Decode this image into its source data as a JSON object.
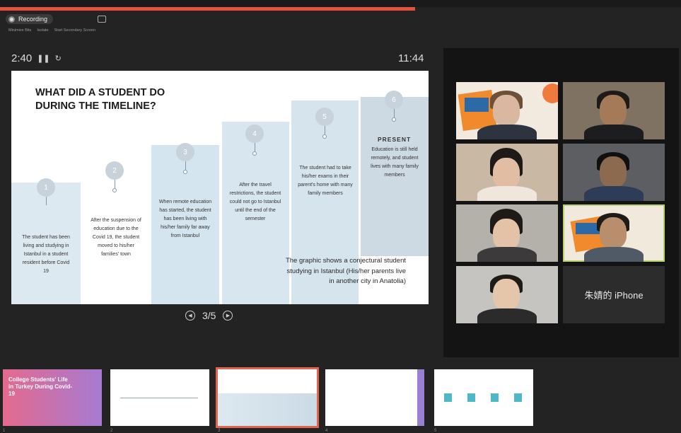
{
  "recording": {
    "label": "Recording",
    "tools": [
      "Minimize Bits",
      "Isolate",
      "Start Secondary Screen"
    ]
  },
  "timer": {
    "elapsed": "2:40",
    "pause_icon": "pause-icon",
    "reset_icon": "reset-icon"
  },
  "clock": "11:44",
  "progress_fraction": 0.61,
  "slide": {
    "title": "WHAT DID A STUDENT DO DURING THE TIMELINE?",
    "steps": [
      {
        "num": "1",
        "text": "The student has been living and studying in Istanbul in a student resident before Covid 19"
      },
      {
        "num": "2",
        "text": "After the suspension of education due to the Covid 19, the student moved to his/her families' town"
      },
      {
        "num": "3",
        "text": "When remote education has started, the student has been living with his/her family far away from Istanbul"
      },
      {
        "num": "4",
        "text": "After the travel restrictions, the student could not go to Istanbul until the end of the semester"
      },
      {
        "num": "5",
        "text": "The student had to take his/her exams in their parent's home with many family members"
      },
      {
        "num": "6",
        "heading": "PRESENT",
        "text": "Education is still held remotely, and student lives with many family members"
      }
    ],
    "caption": "The graphic shows a conjectural student studying in Istanbul (His/her parents live in another city in Anatolia)"
  },
  "pager": {
    "label": "3/5",
    "prev_icon": "prev-icon",
    "next_icon": "next-icon"
  },
  "participants": [
    {
      "name": "",
      "kind": "video"
    },
    {
      "name": "",
      "kind": "video"
    },
    {
      "name": "",
      "kind": "video"
    },
    {
      "name": "",
      "kind": "video"
    },
    {
      "name": "",
      "kind": "video"
    },
    {
      "name": "",
      "kind": "video",
      "active": true
    },
    {
      "name": "",
      "kind": "video"
    },
    {
      "name": "朱婧的 iPhone",
      "kind": "name"
    }
  ],
  "thumbnails": [
    {
      "num": "1",
      "title": "College Students' Life in Turkey During Covid-19"
    },
    {
      "num": "2",
      "title": ""
    },
    {
      "num": "3",
      "title": "",
      "selected": true
    },
    {
      "num": "4",
      "title": ""
    },
    {
      "num": "5",
      "title": ""
    }
  ],
  "colors": {
    "accent": "#e2523e",
    "active_speaker": "#b6d36b",
    "step_blue": "#d6e4ee"
  }
}
